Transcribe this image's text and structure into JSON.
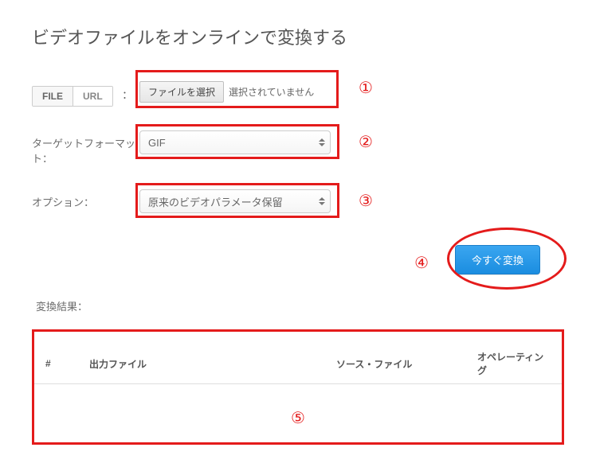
{
  "page": {
    "title": "ビデオファイルをオンラインで変換する"
  },
  "source": {
    "tabs": {
      "file": "FILE",
      "url": "URL"
    },
    "colon": "：",
    "choose_button": "ファイルを選択",
    "no_file_text": "選択されていません"
  },
  "format": {
    "label": "ターゲットフォーマット：",
    "selected": "GIF"
  },
  "options": {
    "label": "オプション：",
    "selected": "原来のビデオパラメータ保留"
  },
  "submit": {
    "label": "今すぐ変換"
  },
  "results": {
    "label": "変換結果：",
    "headers": {
      "index": "#",
      "output": "出力ファイル",
      "source": "ソース・ファイル",
      "operations": "オペレーティング"
    }
  },
  "annotations": {
    "n1": "①",
    "n2": "②",
    "n3": "③",
    "n4": "④",
    "n5": "⑤"
  }
}
